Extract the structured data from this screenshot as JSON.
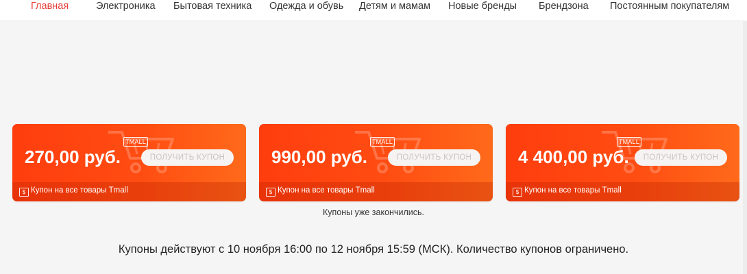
{
  "nav": {
    "items": [
      {
        "label": "Главная",
        "active": true
      },
      {
        "label": "Электроника"
      },
      {
        "label": "Бытовая техника"
      },
      {
        "label": "Одежда и обувь"
      },
      {
        "label": "Детям и мамам"
      },
      {
        "label": "Новые бренды"
      },
      {
        "label": "Брендзона"
      },
      {
        "label": "Постоянным покупателям"
      }
    ]
  },
  "coupons": [
    {
      "badge": "TMALL",
      "price": "270,00 руб.",
      "button": "ПОЛУЧИТЬ КУПОН",
      "footer_icon": "$",
      "footer": "Купон на все товары Tmall"
    },
    {
      "badge": "TMALL",
      "price": "990,00 руб.",
      "button": "ПОЛУЧИТЬ КУПОН",
      "footer_icon": "$",
      "footer": "Купон на все товары Tmall"
    },
    {
      "badge": "TMALL",
      "price": "4 400,00 руб.",
      "button": "ПОЛУЧИТЬ КУПОН",
      "footer_icon": "$",
      "footer": "Купон на все товары Tmall"
    }
  ],
  "status_text": "Купоны уже закончились.",
  "validity_text": "Купоны действуют с 10 ноября 16:00 по 12 ноября 15:59 (МСК). Количество купонов ограничено.",
  "colors": {
    "accent": "#e6403a",
    "coupon": "#ff4d12",
    "background": "#f5f5f5"
  },
  "icons": {
    "cart": "shopping-cart-icon",
    "coupon_footer": "dollar-ticket-icon"
  }
}
